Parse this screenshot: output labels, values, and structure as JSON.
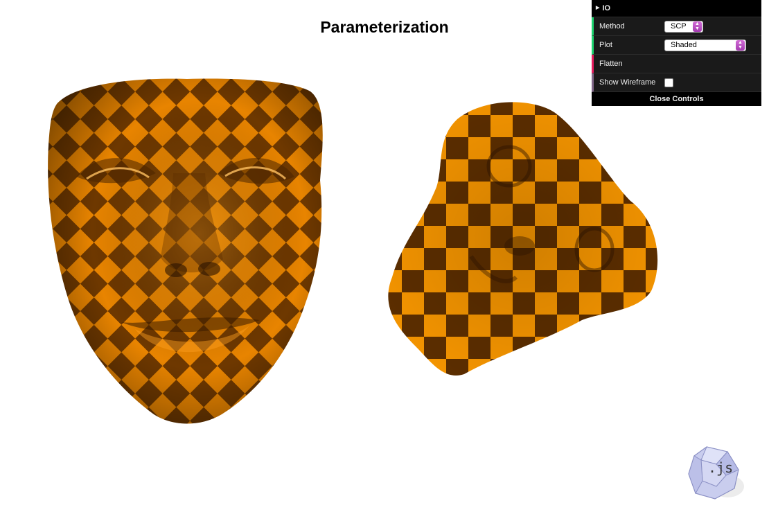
{
  "title": "Parameterization",
  "gui": {
    "folder_label": "IO",
    "method": {
      "label": "Method",
      "value": "SCP"
    },
    "plot": {
      "label": "Plot",
      "value": "Shaded"
    },
    "flatten": {
      "label": "Flatten"
    },
    "wireframe": {
      "label": "Show Wireframe",
      "checked": false
    },
    "close_label": "Close Controls"
  },
  "logo": {
    "text": ".js"
  },
  "colors": {
    "accent_orange": "#ff9900",
    "dark_orange": "#6b3500",
    "gui_bg": "#1a1a1a"
  }
}
